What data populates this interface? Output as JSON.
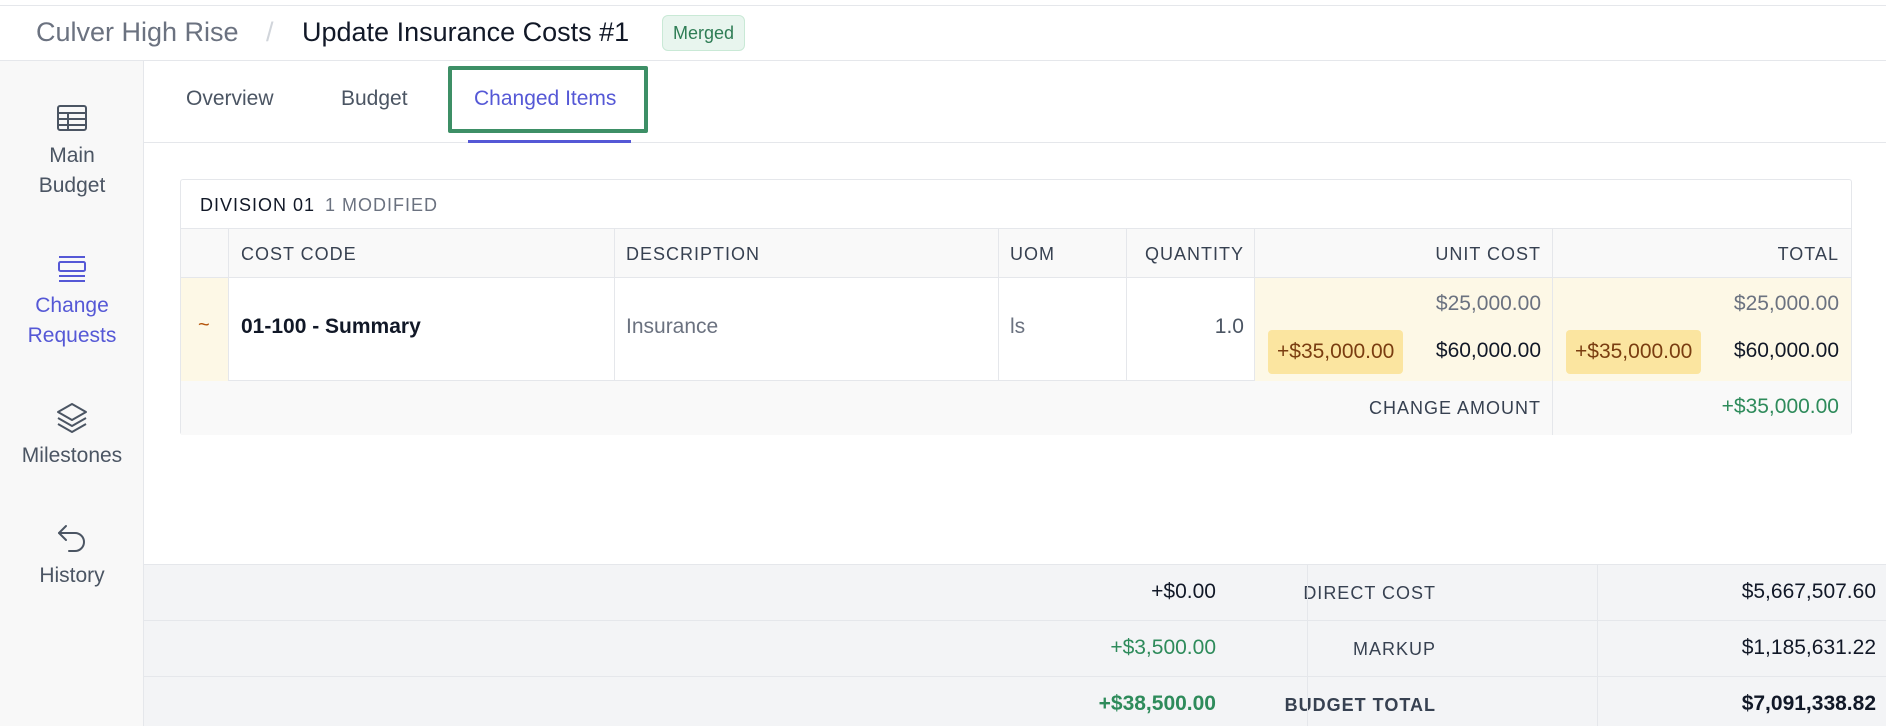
{
  "header": {
    "project": "Culver High Rise",
    "separator": "/",
    "title": "Update Insurance Costs #1",
    "status_badge": "Merged"
  },
  "sidebar": {
    "items": [
      {
        "label_line1": "Main",
        "label_line2": "Budget",
        "icon": "table-icon",
        "active": false
      },
      {
        "label_line1": "Change",
        "label_line2": "Requests",
        "icon": "list-icon",
        "active": true
      },
      {
        "label_line1": "Milestones",
        "label_line2": "",
        "icon": "layers-icon",
        "active": false
      },
      {
        "label_line1": "History",
        "label_line2": "",
        "icon": "undo-icon",
        "active": false
      }
    ]
  },
  "tabs": [
    {
      "label": "Overview",
      "active": false
    },
    {
      "label": "Budget",
      "active": false
    },
    {
      "label": "Changed Items",
      "active": true
    }
  ],
  "division": {
    "name": "DIVISION 01",
    "modified_count": "1 MODIFIED",
    "columns": {
      "cost_code": "COST CODE",
      "description": "DESCRIPTION",
      "uom": "UOM",
      "quantity": "QUANTITY",
      "unit_cost": "UNIT COST",
      "total": "TOTAL"
    },
    "rows": [
      {
        "marker": "~",
        "cost_code": "01-100 - Summary",
        "description": "Insurance",
        "uom": "ls",
        "quantity": "1.0",
        "unit_cost_old": "$25,000.00",
        "unit_cost_delta": "+$35,000.00",
        "unit_cost_new": "$60,000.00",
        "total_old": "$25,000.00",
        "total_delta": "+$35,000.00",
        "total_new": "$60,000.00"
      }
    ],
    "change_amount_label": "CHANGE AMOUNT",
    "change_amount_value": "+$35,000.00"
  },
  "summary": {
    "direct_cost": {
      "label": "DIRECT COST",
      "change": "+$0.00",
      "total": "$5,667,507.60"
    },
    "markup": {
      "label": "MARKUP",
      "change": "+$3,500.00",
      "total": "$1,185,631.22"
    },
    "budget_total": {
      "label": "BUDGET TOTAL",
      "change": "+$38,500.00",
      "total": "$7,091,338.82"
    }
  },
  "colors": {
    "accent": "#5558d6",
    "positive": "#2e8b5b",
    "highlight_border": "#3d8f66",
    "delta_pill": "#fbe5a0"
  }
}
